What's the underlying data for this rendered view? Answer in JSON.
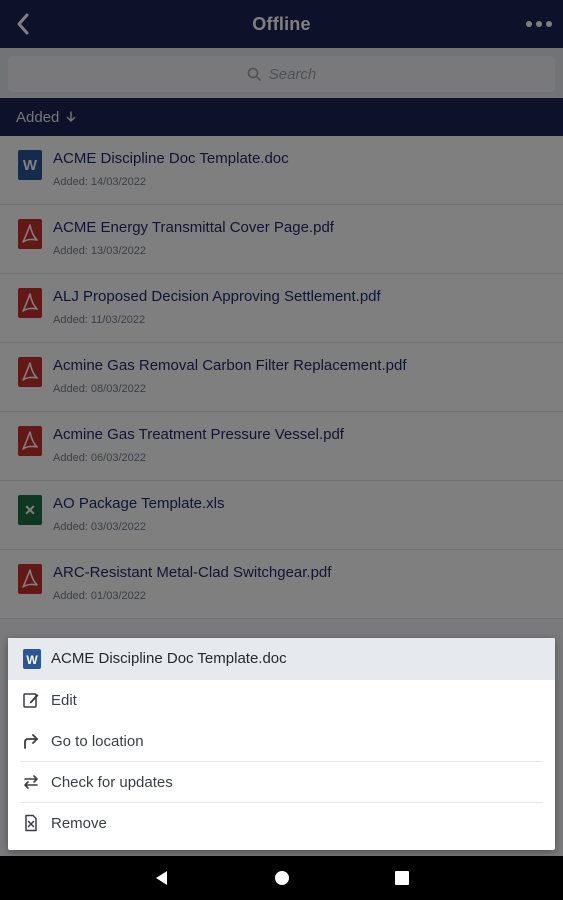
{
  "header": {
    "title": "Offline"
  },
  "search": {
    "placeholder": "Search"
  },
  "sort": {
    "label": "Added"
  },
  "files": [
    {
      "name": "ACME Discipline Doc Template.doc",
      "date": "Added: 14/03/2022",
      "type": "word"
    },
    {
      "name": "ACME Energy Transmittal Cover Page.pdf",
      "date": "Added: 13/03/2022",
      "type": "pdf"
    },
    {
      "name": "ALJ Proposed Decision Approving Settlement.pdf",
      "date": "Added: 11/03/2022",
      "type": "pdf"
    },
    {
      "name": "Acmine Gas Removal Carbon Filter Replacement.pdf",
      "date": "Added: 08/03/2022",
      "type": "pdf"
    },
    {
      "name": "Acmine Gas Treatment Pressure Vessel.pdf",
      "date": "Added: 06/03/2022",
      "type": "pdf"
    },
    {
      "name": "AO Package Template.xls",
      "date": "Added: 03/03/2022",
      "type": "excel"
    },
    {
      "name": "ARC-Resistant Metal-Clad Switchgear.pdf",
      "date": "Added: 01/03/2022",
      "type": "pdf"
    }
  ],
  "sheet": {
    "file_name": "ACME Discipline Doc Template.doc",
    "actions": [
      {
        "label": "Edit",
        "icon": "edit-icon"
      },
      {
        "label": "Go to location",
        "icon": "go-to-location-icon"
      },
      {
        "label": "Check for updates",
        "icon": "sync-icon"
      },
      {
        "label": "Remove",
        "icon": "remove-file-icon"
      }
    ]
  },
  "colors": {
    "brand": "#1b2455",
    "word": "#2b5797",
    "pdf": "#c9302c",
    "excel": "#1e7145"
  }
}
